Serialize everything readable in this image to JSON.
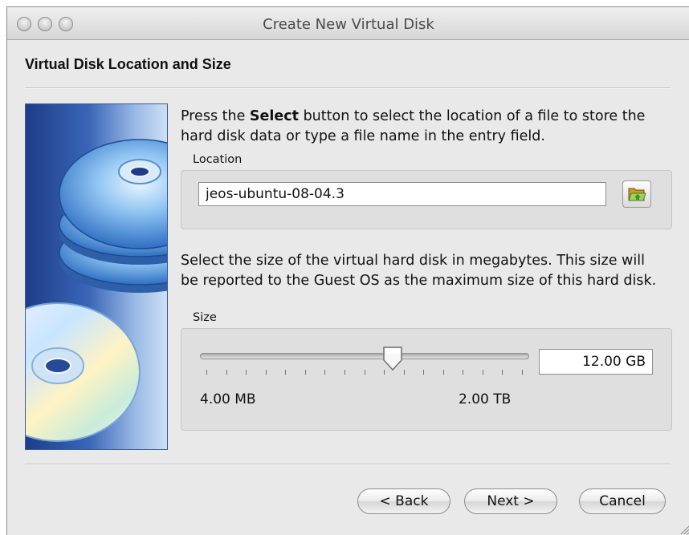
{
  "window": {
    "title": "Create New Virtual Disk"
  },
  "page": {
    "title": "Virtual Disk Location and Size"
  },
  "location_section": {
    "instruction_pre": "Press the ",
    "instruction_bold": "Select",
    "instruction_post": " button to select the location of a file to store the hard disk data or type a file name in the entry field.",
    "label": "Location",
    "value": "jeos-ubuntu-08-04.3",
    "select_icon": "folder-open-icon"
  },
  "size_section": {
    "instruction": "Select the size of the virtual hard disk in megabytes. This size will be reported to the Guest OS as the maximum size of this hard disk.",
    "label": "Size",
    "min_label": "4.00 MB",
    "max_label": "2.00 TB",
    "value": "12.00 GB",
    "slider_fraction": 0.59,
    "tick_count": 17
  },
  "buttons": {
    "back": "< Back",
    "next": "Next >",
    "cancel": "Cancel"
  },
  "icons": {
    "banner": "stacked-disks-icon",
    "traffic_lights": [
      "close-icon",
      "minimize-icon",
      "zoom-icon"
    ]
  }
}
